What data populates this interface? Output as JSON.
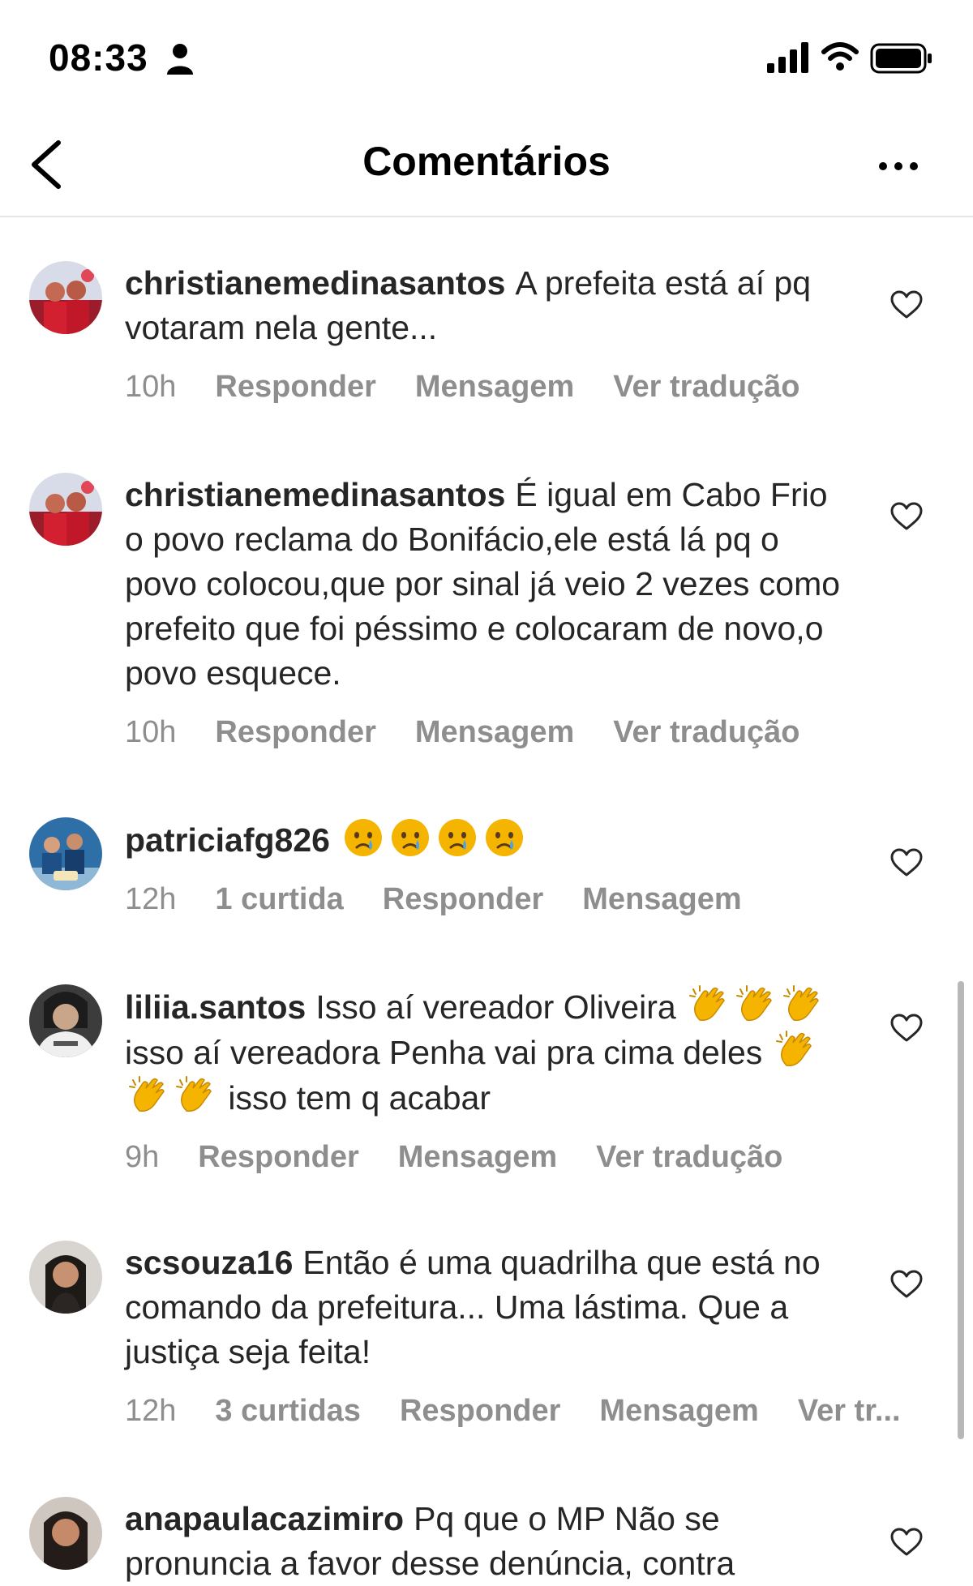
{
  "status_bar": {
    "time": "08:33"
  },
  "header": {
    "title": "Comentários"
  },
  "comments": [
    {
      "username": "christianemedinasantos",
      "text": "A prefeita está aí pq votaram nela gente...",
      "time": "10h",
      "reply": "Responder",
      "message": "Mensagem",
      "translate": "Ver tradução"
    },
    {
      "username": "christianemedinasantos",
      "text": "É igual em Cabo Frio o povo reclama do Bonifácio,ele está lá pq o povo colocou,que por sinal já veio 2  vezes como prefeito que foi péssimo e colocaram de novo,o povo esquece.",
      "time": "10h",
      "reply": "Responder",
      "message": "Mensagem",
      "translate": "Ver tradução"
    },
    {
      "username": "patriciafg826",
      "emoji": "😢",
      "time": "12h",
      "likes": "1 curtida",
      "reply": "Responder",
      "message": "Mensagem"
    },
    {
      "username": "liliia.santos",
      "text_1": "Isso aí vereador Oliveira",
      "text_2": "isso aí vereadora Penha vai pra cima deles",
      "text_3": "isso tem q acabar",
      "emoji": "👏",
      "time": "9h",
      "reply": "Responder",
      "message": "Mensagem",
      "translate": "Ver tradução"
    },
    {
      "username": "scsouza16",
      "text": "Então é uma quadrilha que está no comando da prefeitura... Uma lástima. Que a justiça seja feita!",
      "time": "12h",
      "likes": "3 curtidas",
      "reply": "Responder",
      "message": "Mensagem",
      "translate": "Ver tr..."
    },
    {
      "username": "anapaulacazimiro",
      "text": "Pq que o MP Não se pronuncia a favor desse denúncia, contra"
    }
  ],
  "icons": {
    "back": "chevron-left-icon",
    "more": "more-horizontal-icon",
    "like": "heart-outline-icon",
    "crying": "crying-face-emoji",
    "clap": "clapping-hands-emoji"
  },
  "colors": {
    "text": "#262626",
    "secondary": "#8e8e8e",
    "divider": "#e6e6e6",
    "emoji_yellow": "#f4b400"
  }
}
